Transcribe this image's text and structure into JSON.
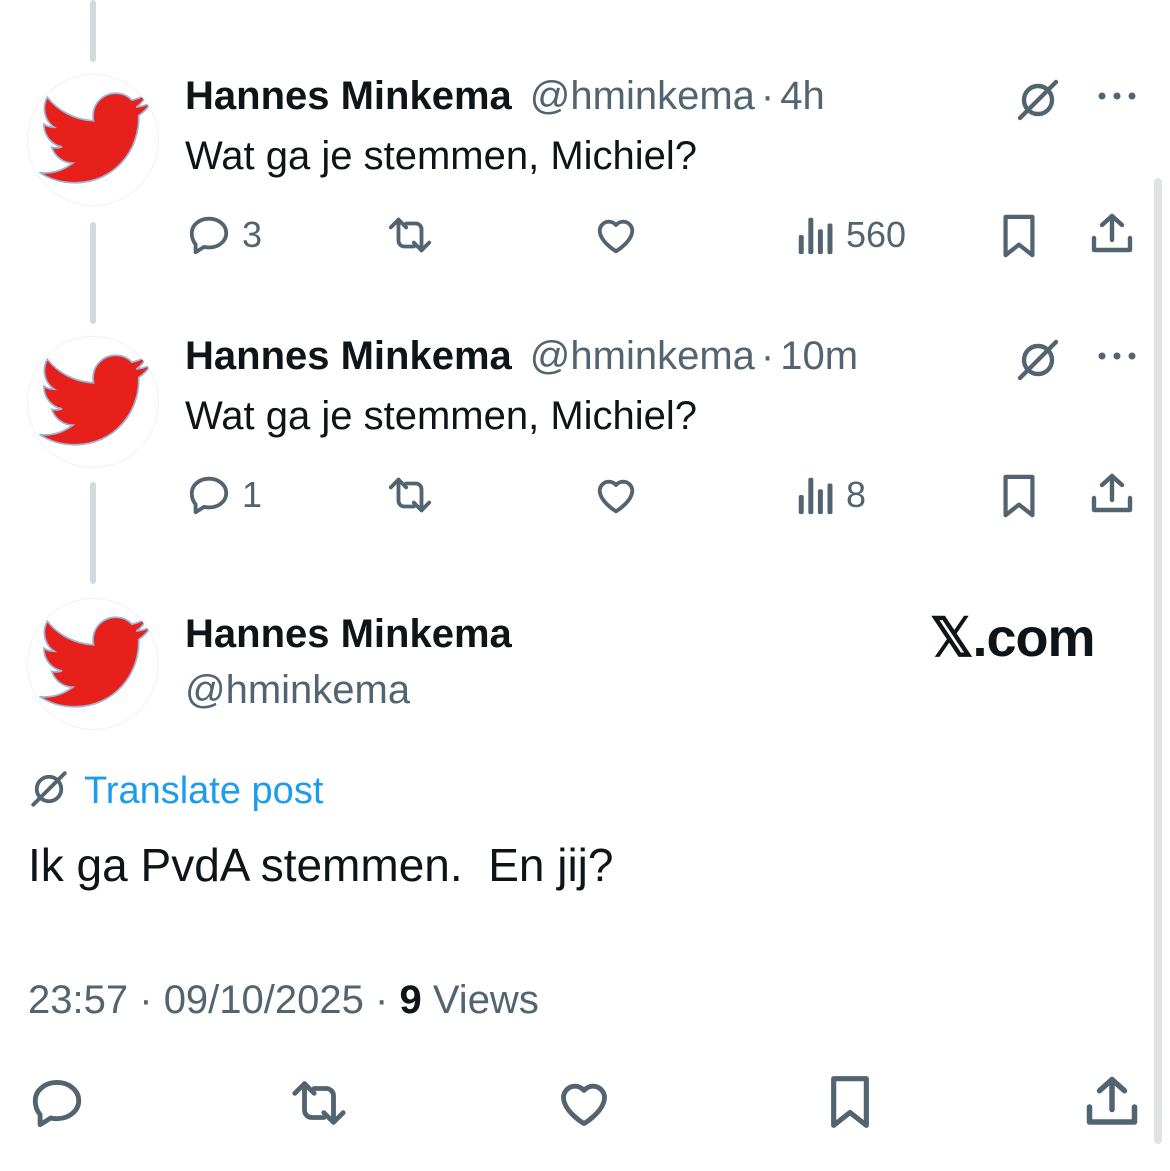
{
  "colors": {
    "text": "#0f1419",
    "secondary": "#536471",
    "link": "#1d9bf0",
    "thread_line": "#cfd9de",
    "avatar_bird": "#e8201b"
  },
  "replies": [
    {
      "display_name": "Hannes Minkema",
      "handle": "@hminkema",
      "separator": "·",
      "time": "4h",
      "text": "Wat ga je stemmen, Michiel?",
      "stats": {
        "replies": "3",
        "views": "560"
      },
      "icons": [
        "globe-slash-icon",
        "more-icon",
        "reply-icon",
        "repost-icon",
        "like-icon",
        "views-icon",
        "bookmark-icon",
        "share-icon"
      ]
    },
    {
      "display_name": "Hannes Minkema",
      "handle": "@hminkema",
      "separator": "·",
      "time": "10m",
      "text": "Wat ga je stemmen, Michiel?",
      "stats": {
        "replies": "1",
        "views": "8"
      },
      "icons": [
        "globe-slash-icon",
        "more-icon",
        "reply-icon",
        "repost-icon",
        "like-icon",
        "views-icon",
        "bookmark-icon",
        "share-icon"
      ]
    }
  ],
  "main_post": {
    "display_name": "Hannes Minkema",
    "handle": "@hminkema",
    "watermark": "𝕏.com",
    "translate_label": "Translate post",
    "text": "Ik ga PvdA stemmen.  En jij?",
    "time": "23:57",
    "date": "09/10/2025",
    "separator": "·",
    "views_count": "9",
    "views_label": "Views",
    "action_icons": [
      "reply-icon",
      "repost-icon",
      "like-icon",
      "bookmark-icon",
      "share-icon"
    ]
  }
}
